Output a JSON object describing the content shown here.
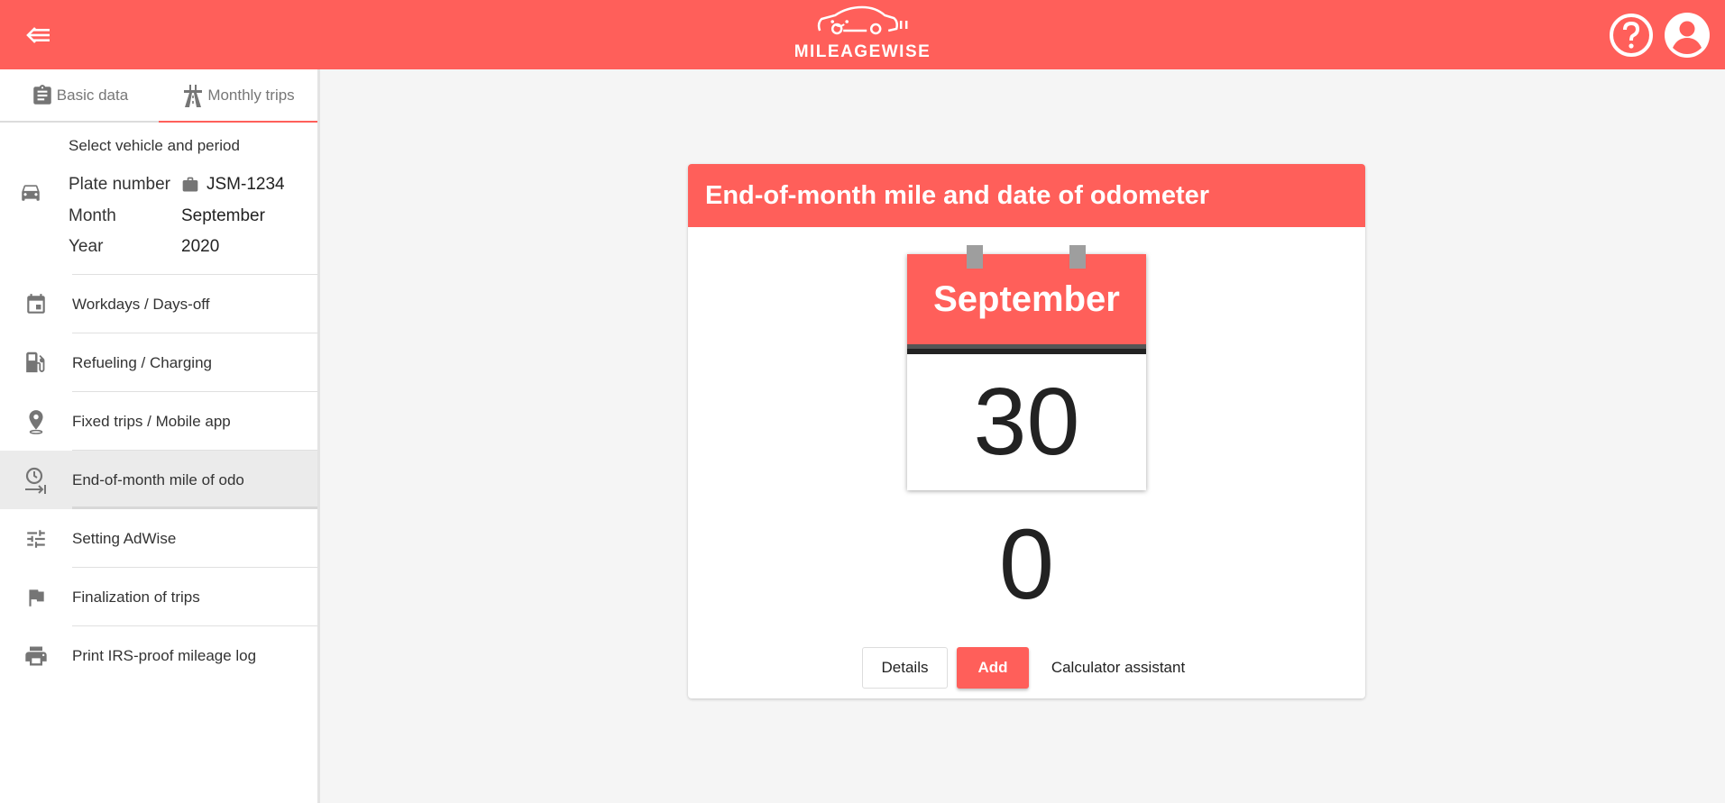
{
  "header": {
    "logo_text": "MILEAGEWISE",
    "back_icon": "back-menu-icon",
    "help_icon": "help-icon",
    "account_icon": "account-icon"
  },
  "tabs": [
    {
      "label": "Basic data",
      "icon": "clipboard-icon"
    },
    {
      "label": "Monthly trips",
      "icon": "road-icon"
    }
  ],
  "period": {
    "title": "Select vehicle and period",
    "plate_label": "Plate number",
    "plate_value": "JSM-1234",
    "month_label": "Month",
    "month_value": "September",
    "year_label": "Year",
    "year_value": "2020"
  },
  "menu": [
    {
      "label": "Workdays / Days-off",
      "icon": "calendar-icon"
    },
    {
      "label": "Refueling / Charging",
      "icon": "fuel-icon"
    },
    {
      "label": "Fixed trips / Mobile app",
      "icon": "location-pin-icon"
    },
    {
      "label": "End-of-month mile of odo",
      "icon": "odometer-clock-icon",
      "active": true
    },
    {
      "label": "Setting AdWise",
      "icon": "sliders-icon"
    },
    {
      "label": "Finalization of trips",
      "icon": "flag-icon"
    },
    {
      "label": "Print IRS-proof mileage log",
      "icon": "printer-icon"
    }
  ],
  "card": {
    "title": "End-of-month mile and date of odometer",
    "calendar_month": "September",
    "calendar_day": "30",
    "mileage": "0",
    "details_label": "Details",
    "add_label": "Add",
    "calculator_label": "Calculator assistant"
  },
  "colors": {
    "accent": "#ff5f5a",
    "background": "#f5f5f5"
  }
}
